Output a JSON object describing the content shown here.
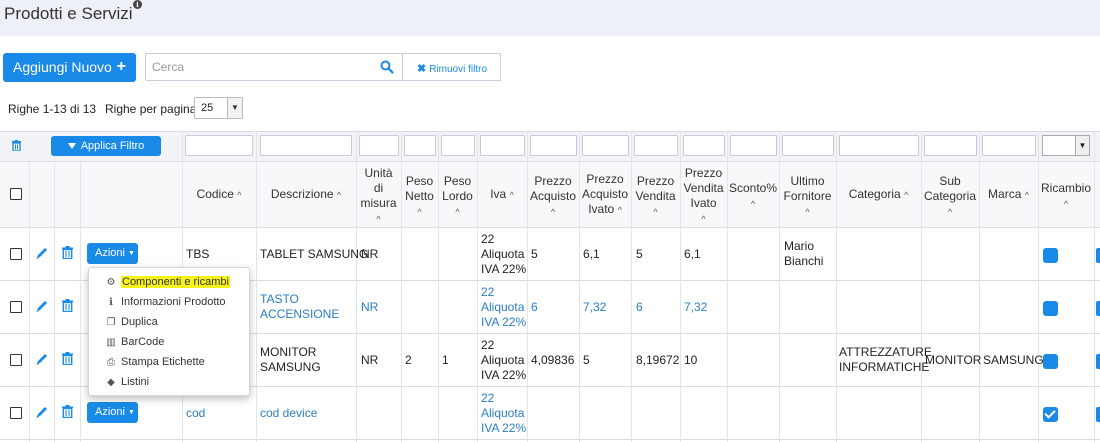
{
  "header": {
    "title": "Prodotti e Servizi",
    "info_icon": "info-circle-icon"
  },
  "toolbar": {
    "add_label": "Aggiungi Nuovo",
    "search_placeholder": "Cerca",
    "remove_filter_label": "Rimuovi filtro"
  },
  "pagination": {
    "rows_info": "Righe 1-13 di 13",
    "per_page_label": "Righe per pagina",
    "per_page_value": "25"
  },
  "filters": {
    "apply_label": "Applica Filtro"
  },
  "columns": {
    "codice": "Codice",
    "descrizione": "Descrizione",
    "unita_1": "Unità",
    "unita_2": "di",
    "unita_3": "misura",
    "peso_netto_1": "Peso",
    "peso_netto_2": "Netto",
    "peso_lordo_1": "Peso",
    "peso_lordo_2": "Lordo",
    "iva": "Iva",
    "prezzo_acq_1": "Prezzo",
    "prezzo_acq_2": "Acquisto",
    "prezzo_acq_ivato_1": "Prezzo",
    "prezzo_acq_ivato_2": "Acquisto",
    "prezzo_acq_ivato_3": "Ivato",
    "prezzo_vend_1": "Prezzo",
    "prezzo_vend_2": "Vendita",
    "prezzo_vend_ivato_1": "Prezzo",
    "prezzo_vend_ivato_2": "Vendita",
    "prezzo_vend_ivato_3": "Ivato",
    "sconto": "Sconto%",
    "fornitore_1": "Ultimo",
    "fornitore_2": "Fornitore",
    "categoria": "Categoria",
    "sub_cat_1": "Sub",
    "sub_cat_2": "Categoria",
    "marca": "Marca",
    "ricambio": "Ricambio",
    "sort_glyph": "^"
  },
  "actions_label": "Azioni",
  "rows": [
    {
      "codice": "TBS",
      "descrizione": "TABLET SAMSUNG",
      "unita": "NR",
      "peso_netto": "",
      "peso_lordo": "",
      "iva_1": "22",
      "iva_2": "Aliquota",
      "iva_3": "IVA 22%",
      "prezzo_acq": "5",
      "prezzo_acq_ivato": "6,1",
      "prezzo_vend": "5",
      "prezzo_vend_ivato": "6,1",
      "fornitore_1": "Mario",
      "fornitore_2": "Bianchi",
      "categoria_1": "",
      "categoria_2": "",
      "sub_categoria": "",
      "marca": "",
      "ricambio": false
    },
    {
      "codice": "",
      "descrizione_1": "TASTO",
      "descrizione_2": "ACCENSIONE",
      "unita": "NR",
      "iva_1": "22",
      "iva_2": "Aliquota",
      "iva_3": "IVA 22%",
      "prezzo_acq": "6",
      "prezzo_acq_ivato": "7,32",
      "prezzo_vend": "6",
      "prezzo_vend_ivato": "7,32",
      "ricambio": false
    },
    {
      "codice": "",
      "descrizione_1": "MONITOR",
      "descrizione_2": "SAMSUNG",
      "unita": "NR",
      "peso_netto": "2",
      "peso_lordo": "1",
      "iva_1": "22",
      "iva_2": "Aliquota",
      "iva_3": "IVA 22%",
      "prezzo_acq": "4,09836",
      "prezzo_acq_ivato": "5",
      "prezzo_vend": "8,19672",
      "prezzo_vend_ivato": "10",
      "categoria_1": "ATTREZZATURE",
      "categoria_2": "INFORMATICHE",
      "sub_categoria": "MONITOR",
      "marca": "SAMSUNG",
      "ricambio": false
    },
    {
      "codice": "cod",
      "descrizione": "cod device",
      "iva_1": "22",
      "iva_2": "Aliquota",
      "iva_3": "IVA 22%",
      "ricambio": true
    }
  ],
  "actions_menu": [
    {
      "label": "Componenti e ricambi",
      "icon": "cogs-icon",
      "highlight": true
    },
    {
      "label": "Informazioni Prodotto",
      "icon": "info-icon"
    },
    {
      "label": "Duplica",
      "icon": "copy-icon"
    },
    {
      "label": "BarCode",
      "icon": "barcode-icon"
    },
    {
      "label": "Stampa Etichette",
      "icon": "print-icon"
    },
    {
      "label": "Listini",
      "icon": "tags-icon"
    }
  ]
}
